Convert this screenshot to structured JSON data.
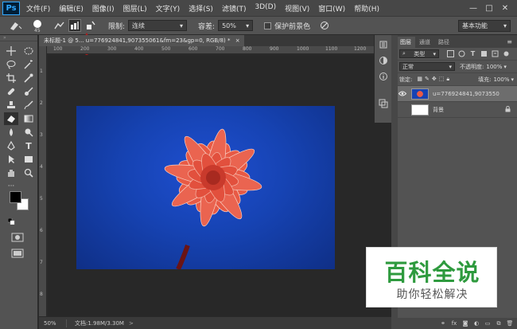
{
  "app": {
    "logo": "Ps"
  },
  "menu": {
    "items": [
      "文件(F)",
      "编辑(E)",
      "图像(I)",
      "图层(L)",
      "文字(Y)",
      "选择(S)",
      "滤镜(T)",
      "3D(D)",
      "视图(V)",
      "窗口(W)",
      "帮助(H)"
    ]
  },
  "window_controls": {
    "minimize": "—",
    "maximize": "□",
    "close": "✕"
  },
  "options": {
    "brush_size": "45",
    "limit_label": "限制:",
    "limit_value": "连续",
    "tolerance_label": "容差:",
    "tolerance_value": "50%",
    "protect_label": "保护前景色",
    "workspace": "基本功能"
  },
  "document": {
    "tab_title": "未标题-1 @ 5...",
    "tab_title_rest": "u=776924841,907355061&fm=23&gp=0, RGB/8) *",
    "close": "×"
  },
  "rulers": {
    "top": [
      "100",
      "200",
      "300",
      "400",
      "500",
      "600",
      "700",
      "800",
      "900",
      "1000",
      "1100",
      "1200"
    ],
    "left": [
      "1",
      "2",
      "3",
      "4",
      "5",
      "6",
      "7",
      "8"
    ]
  },
  "status": {
    "zoom": "50%",
    "doc_info": "文档:1.98M/3.30M",
    "arrow": ">"
  },
  "layers_panel": {
    "tabs": [
      "图层",
      "通道",
      "路径"
    ],
    "filter_kind": "类型",
    "blend_mode": "正常",
    "opacity_label": "不透明度:",
    "opacity_value": "100%",
    "lock_label": "锁定:",
    "fill_label": "填充:",
    "fill_value": "100%",
    "layers": [
      {
        "name": "u=776924841,907355061...",
        "selected": true
      },
      {
        "name": "背景",
        "selected": false
      }
    ],
    "footer_icons": [
      "fx"
    ]
  },
  "watermark": {
    "title": "百科全说",
    "subtitle": "助你轻松解决"
  },
  "colors": {
    "accent_red": "#b11a1a",
    "image_blue": "#1643b3",
    "flower": "#e8543f",
    "watermark_green": "#2e9a3e"
  }
}
